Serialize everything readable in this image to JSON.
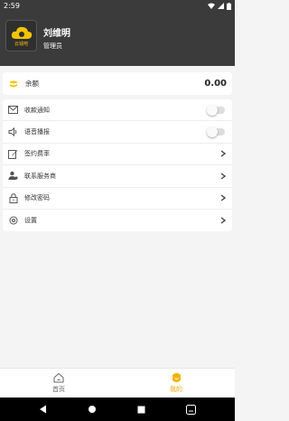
{
  "status_bar": {
    "time": "2:59"
  },
  "profile": {
    "name": "刘维明",
    "role": "管理员",
    "avatar_text": "云钱吧"
  },
  "balance": {
    "label": "余额",
    "amount": "0.00"
  },
  "menu": [
    {
      "label": "收款通知",
      "control": "toggle",
      "icon": "mail-icon"
    },
    {
      "label": "语音播报",
      "control": "toggle",
      "icon": "speaker-icon"
    },
    {
      "label": "签约费率",
      "control": "chevron",
      "icon": "edit-icon"
    },
    {
      "label": "联系服务商",
      "control": "chevron",
      "icon": "contact-icon"
    },
    {
      "label": "修改密码",
      "control": "chevron",
      "icon": "lock-icon"
    },
    {
      "label": "设置",
      "control": "chevron",
      "icon": "gear-icon"
    }
  ],
  "tabs": {
    "home": "首页",
    "mine": "我的"
  },
  "colors": {
    "header": "#3b3b3b",
    "accent": "#f5c400",
    "active_tab": "#e9a800"
  }
}
